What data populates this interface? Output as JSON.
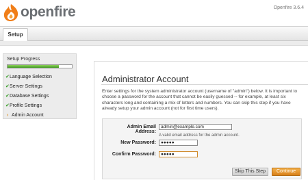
{
  "header": {
    "logo_text": "openfire",
    "logo_tm": "™",
    "version": "Openfire 3.6.4"
  },
  "tabs": [
    {
      "label": "Setup"
    }
  ],
  "sidebar": {
    "progress_label": "Setup Progress",
    "progress_fraction": 0.8,
    "steps": [
      {
        "label": "Language Selection",
        "status": "done"
      },
      {
        "label": "Server Settings",
        "status": "done"
      },
      {
        "label": "Database Settings",
        "status": "done"
      },
      {
        "label": "Profile Settings",
        "status": "done"
      },
      {
        "label": "Admin Account",
        "status": "current"
      }
    ]
  },
  "main": {
    "title": "Administrator Account",
    "intro": "Enter settings for the system administrator account (username of \"admin\") below. It is important to choose a password for the account that cannot be easily guessed -- for example, at least six characters long and containing a mix of letters and numbers. You can skip this step if you have already setup your admin account (not for first time users).",
    "form": {
      "email_label": "Admin Email Address:",
      "email_value": "admin@example.com",
      "email_hint": "A valid email address for the admin account.",
      "new_password_label": "New Password:",
      "new_password_value": "●●●●●",
      "confirm_password_label": "Confirm Password:",
      "confirm_password_value": "●●●●●"
    },
    "buttons": {
      "skip": "Skip This Step",
      "continue": "Continue"
    }
  },
  "icons": {
    "logo": "openfire-flame-icon",
    "done": "check-icon",
    "current": "arrow-right-icon"
  },
  "colors": {
    "progress": "#5cb832",
    "accent": "#e08b1e",
    "check": "#2f9a1e"
  }
}
